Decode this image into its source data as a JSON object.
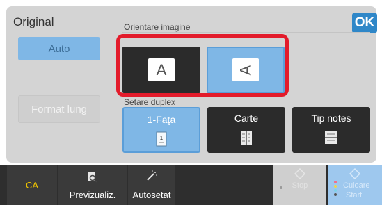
{
  "header": {
    "title": "Original",
    "ok_label": "OK"
  },
  "left": {
    "auto_label": "Auto",
    "format_label": "Format lung"
  },
  "orientation": {
    "label": "Orientare imagine",
    "options": [
      {
        "glyph": "A",
        "selected": false
      },
      {
        "glyph": "A",
        "selected": true
      }
    ]
  },
  "duplex": {
    "label": "Setare duplex",
    "options": [
      {
        "label": "1-Faţa",
        "selected": true
      },
      {
        "label": "Carte",
        "selected": false
      },
      {
        "label": "Tip notes",
        "selected": false
      }
    ]
  },
  "bottom_bar": {
    "ca_label": "CA",
    "preview_label": "Previzualiz.",
    "autoset_label": "Autosetat",
    "stop_label": "Stop",
    "color_label": "Culoare",
    "start_label": "Start"
  },
  "colors": {
    "accent": "#2f87c8",
    "selected": "#7fb7e6",
    "highlight": "#e31b2b",
    "dark_button": "#2b2b2b"
  }
}
